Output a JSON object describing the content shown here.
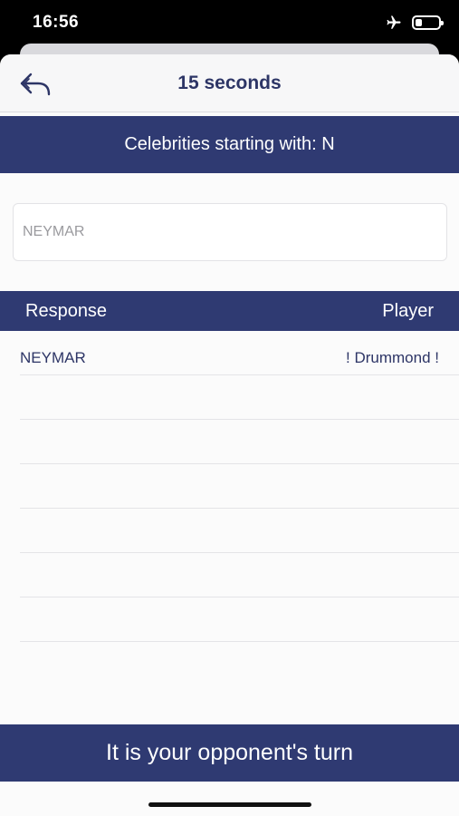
{
  "status_bar": {
    "time": "16:56",
    "icons": [
      "airplane-mode-icon",
      "battery-icon"
    ],
    "battery_level": 0.3
  },
  "nav": {
    "back_icon": "reply-back-icon",
    "title": "15 seconds"
  },
  "category": {
    "text": "Celebrities starting with: N"
  },
  "answer_input": {
    "placeholder": "NEYMAR",
    "value": ""
  },
  "table": {
    "columns": [
      "Response",
      "Player"
    ],
    "rows": [
      {
        "response": "NEYMAR",
        "player": "! Drummond !"
      },
      {
        "response": "",
        "player": ""
      },
      {
        "response": "",
        "player": ""
      },
      {
        "response": "",
        "player": ""
      },
      {
        "response": "",
        "player": ""
      },
      {
        "response": "",
        "player": ""
      },
      {
        "response": "",
        "player": ""
      }
    ]
  },
  "turn_banner": {
    "text": "It is your opponent's turn"
  },
  "colors": {
    "primary": "#2f3a72",
    "title_text": "#2d3566",
    "background": "#fbfbfb"
  }
}
